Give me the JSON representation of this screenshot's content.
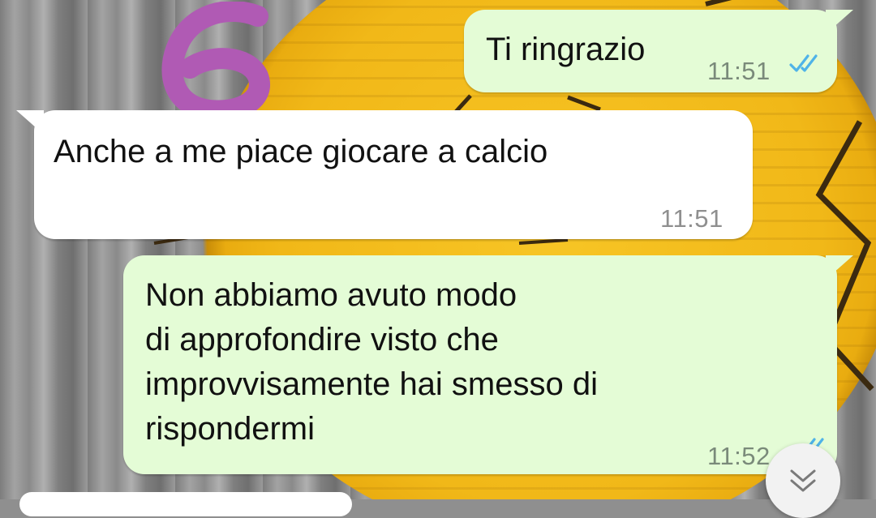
{
  "messages": [
    {
      "direction": "outgoing",
      "text": "Ti ringrazio",
      "time": "11:51",
      "status": "read"
    },
    {
      "direction": "incoming",
      "text": "Anche a me piace giocare a calcio",
      "time": "11:51"
    },
    {
      "direction": "outgoing",
      "text": "Non abbiamo avuto modo\ndi approfondire visto che\nimprovvisamente hai smesso di\nrispondermi",
      "time": "11:52",
      "status": "read"
    }
  ],
  "annotation": {
    "label": "6",
    "color": "#b05ab4"
  },
  "icons": {
    "read_ticks": "double-check-icon",
    "scroll_down": "double-chevron-down-icon"
  },
  "colors": {
    "outgoing_bubble": "#e4fcd6",
    "incoming_bubble": "#ffffff",
    "read_tick": "#4fb3e8"
  }
}
